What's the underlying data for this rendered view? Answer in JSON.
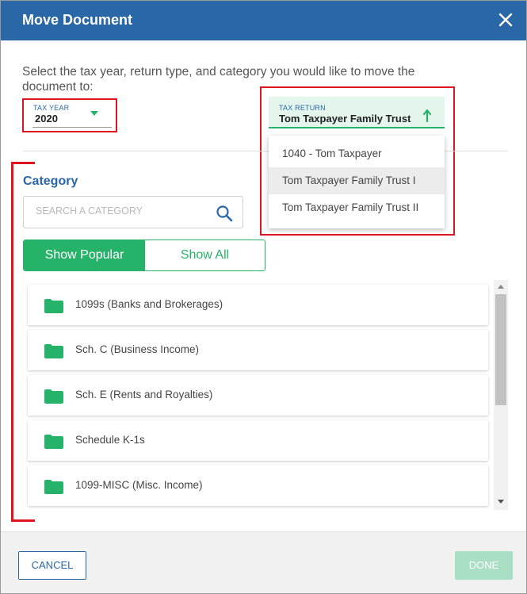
{
  "dialog": {
    "title": "Move Document",
    "instruction": "Select the tax year, return type, and category you would like to move the document to:"
  },
  "tax_year": {
    "label": "TAX YEAR",
    "value": "2020"
  },
  "tax_return": {
    "label": "TAX RETURN",
    "value": "Tom Taxpayer Family Trust",
    "options": [
      "1040 - Tom Taxpayer",
      "Tom Taxpayer Family Trust I",
      "Tom Taxpayer Family Trust II"
    ],
    "highlighted_option": "Tom Taxpayer Family Trust I"
  },
  "category": {
    "heading": "Category",
    "search_placeholder": "SEARCH A CATEGORY",
    "toggle": {
      "popular": "Show Popular",
      "all": "Show All",
      "active": "popular"
    },
    "items": [
      "1099s (Banks and Brokerages)",
      "Sch. C (Business Income)",
      "Sch. E (Rents and Royalties)",
      "Schedule K-1s",
      "1099-MISC (Misc. Income)"
    ]
  },
  "footer": {
    "cancel": "CANCEL",
    "done": "DONE"
  },
  "icons": {
    "close": "close-icon",
    "dropdown": "chevron-down-icon",
    "sort": "arrow-up-icon",
    "search": "search-icon",
    "folder": "folder-icon"
  },
  "colors": {
    "header": "#2a67a7",
    "accent_green": "#27b26a",
    "annotation_red": "#e0141e",
    "done_disabled": "#a9e0c5"
  }
}
